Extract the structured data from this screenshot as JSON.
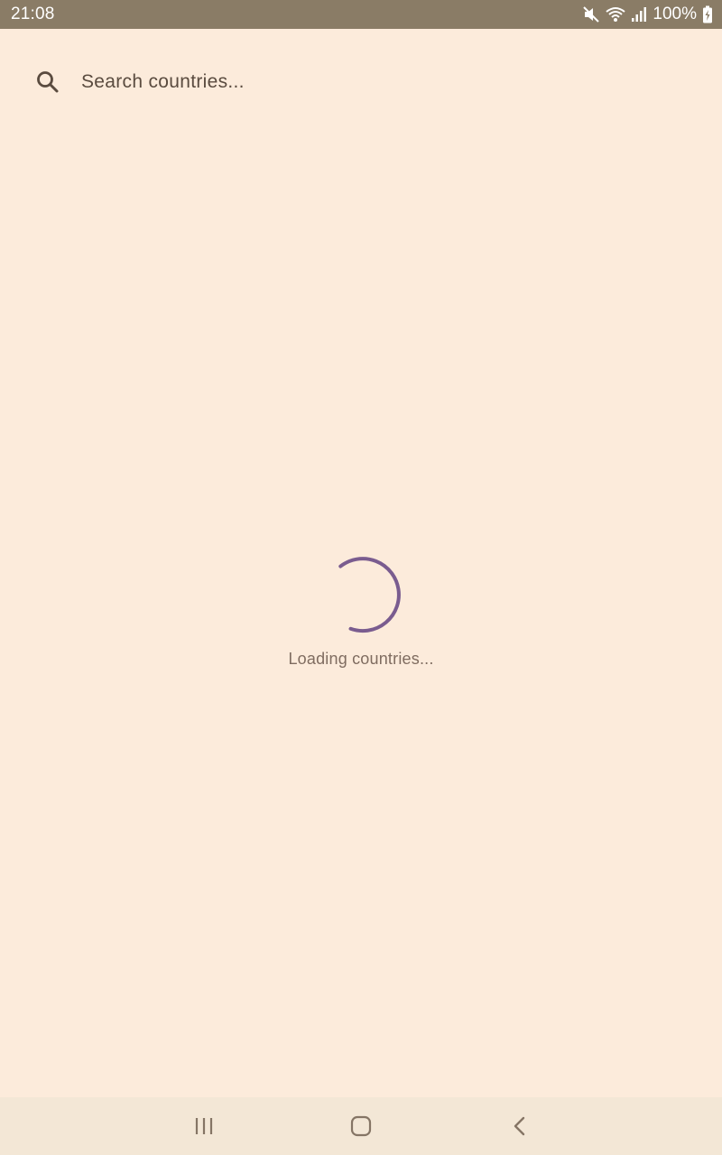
{
  "status_bar": {
    "time": "21:08",
    "battery_percent": "100%",
    "icons": [
      "mute-icon",
      "wifi-icon",
      "signal-icon",
      "battery-charging-icon"
    ]
  },
  "search": {
    "placeholder": "Search countries...",
    "value": "",
    "icon": "search-icon"
  },
  "loading": {
    "text": "Loading countries...",
    "spinner_color": "#7A5C8F"
  },
  "nav_bar": {
    "buttons": [
      "recent-apps",
      "home",
      "back"
    ]
  },
  "colors": {
    "background": "#FCEBDB",
    "status_bar": "#8A7C66",
    "nav_bar": "#F3E7D6",
    "accent": "#7A5C8F"
  }
}
